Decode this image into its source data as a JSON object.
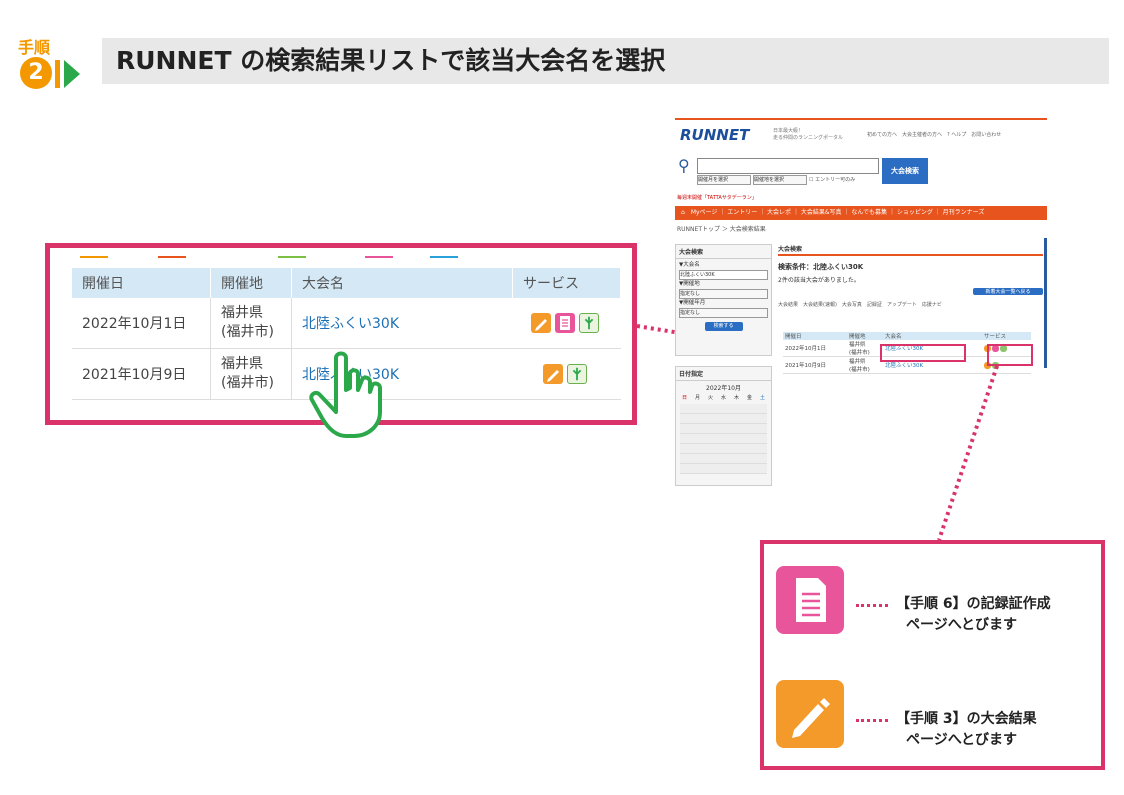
{
  "step": {
    "label": "手順",
    "number": "2"
  },
  "title": "RUNNET の検索結果リストで該当大会名を選択",
  "zoom_table": {
    "headers": [
      "開催日",
      "開催地",
      "大会名",
      "サービス"
    ],
    "rows": [
      {
        "date": "2022年10月1日",
        "pref": "福井県",
        "city": "(福井市)",
        "name": "北陸ふくい30K"
      },
      {
        "date": "2021年10月9日",
        "pref": "福井県",
        "city": "(福井市)",
        "name": "北陸ふくい30K"
      }
    ]
  },
  "mini": {
    "logo": "RUNNET",
    "tagline_1": "日本最大級！",
    "tagline_2": "走る仲間のランニングポータル",
    "header_links": "初めての方へ　大会主催者の方へ　? ヘルプ　お問い合わせ",
    "search_button": "大会検索",
    "select_month": "開催月を選択",
    "select_place": "開催地を選択",
    "entry_checkbox": "エントリー可のみ",
    "news": "毎週末開催「TATTAサタデーラン」",
    "nav": "Myページ ｜ エントリー ｜ 大会レポ ｜ 大会結果&写真 ｜ なんでも募集 ｜ ショッピング ｜ 月刊ランナーズ",
    "breadcrumb": "RUNNETトップ ＞ 大会検索結果",
    "side_title": "大会検索",
    "side_name_label": "▼大会名",
    "side_name_value": "北陸ふくい30K",
    "side_place_label": "▼開催地",
    "side_place_value": "指定なし",
    "side_month_label": "▼開催年月",
    "side_month_value": "指定なし",
    "side_search": "検索する",
    "cal_title": "日付指定",
    "cal_month": "2022年10月",
    "cal_days": [
      "日",
      "月",
      "火",
      "水",
      "木",
      "金",
      "土"
    ],
    "main_title": "大会検索",
    "condition": "検索条件：北陸ふくい30K",
    "count": "2件の該当大会がありました。",
    "new_list": "新着大会一覧へ戻る",
    "legend_row": "大会結果　大会結果(速報)　大会写真　記録証　アップデート　応援ナビ",
    "headers": [
      "開催日",
      "開催地",
      "大会名",
      "サービス"
    ],
    "rows": [
      {
        "date": "2022年10月1日",
        "pref": "福井県",
        "city": "(福井市)",
        "name": "北陸ふくい30K"
      },
      {
        "date": "2021年10月9日",
        "pref": "福井県",
        "city": "(福井市)",
        "name": "北陸ふくい30K"
      }
    ]
  },
  "legend": {
    "record_line1": "【手順 6】の記録証作成",
    "record_line2": "ページへとびます",
    "result_line1": "【手順 3】の大会結果",
    "result_line2": "ページへとびます"
  },
  "colors": {
    "accent": "#d9336a",
    "orange": "#f39800",
    "green": "#2aa84a",
    "pink_icon": "#e8559a",
    "orange_icon": "#f39a2b",
    "link": "#1d6fb5"
  }
}
